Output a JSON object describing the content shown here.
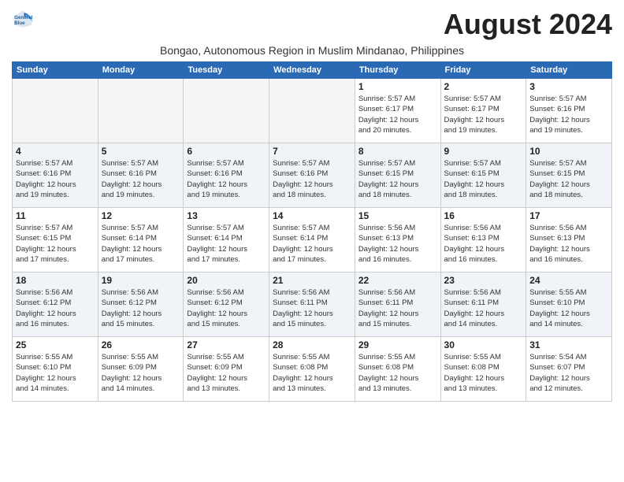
{
  "logo": {
    "general": "General",
    "blue": "Blue"
  },
  "title": "August 2024",
  "subtitle": "Bongao, Autonomous Region in Muslim Mindanao, Philippines",
  "weekdays": [
    "Sunday",
    "Monday",
    "Tuesday",
    "Wednesday",
    "Thursday",
    "Friday",
    "Saturday"
  ],
  "weeks": [
    [
      {
        "day": "",
        "info": ""
      },
      {
        "day": "",
        "info": ""
      },
      {
        "day": "",
        "info": ""
      },
      {
        "day": "",
        "info": ""
      },
      {
        "day": "1",
        "info": "Sunrise: 5:57 AM\nSunset: 6:17 PM\nDaylight: 12 hours\nand 20 minutes."
      },
      {
        "day": "2",
        "info": "Sunrise: 5:57 AM\nSunset: 6:17 PM\nDaylight: 12 hours\nand 19 minutes."
      },
      {
        "day": "3",
        "info": "Sunrise: 5:57 AM\nSunset: 6:16 PM\nDaylight: 12 hours\nand 19 minutes."
      }
    ],
    [
      {
        "day": "4",
        "info": "Sunrise: 5:57 AM\nSunset: 6:16 PM\nDaylight: 12 hours\nand 19 minutes."
      },
      {
        "day": "5",
        "info": "Sunrise: 5:57 AM\nSunset: 6:16 PM\nDaylight: 12 hours\nand 19 minutes."
      },
      {
        "day": "6",
        "info": "Sunrise: 5:57 AM\nSunset: 6:16 PM\nDaylight: 12 hours\nand 19 minutes."
      },
      {
        "day": "7",
        "info": "Sunrise: 5:57 AM\nSunset: 6:16 PM\nDaylight: 12 hours\nand 18 minutes."
      },
      {
        "day": "8",
        "info": "Sunrise: 5:57 AM\nSunset: 6:15 PM\nDaylight: 12 hours\nand 18 minutes."
      },
      {
        "day": "9",
        "info": "Sunrise: 5:57 AM\nSunset: 6:15 PM\nDaylight: 12 hours\nand 18 minutes."
      },
      {
        "day": "10",
        "info": "Sunrise: 5:57 AM\nSunset: 6:15 PM\nDaylight: 12 hours\nand 18 minutes."
      }
    ],
    [
      {
        "day": "11",
        "info": "Sunrise: 5:57 AM\nSunset: 6:15 PM\nDaylight: 12 hours\nand 17 minutes."
      },
      {
        "day": "12",
        "info": "Sunrise: 5:57 AM\nSunset: 6:14 PM\nDaylight: 12 hours\nand 17 minutes."
      },
      {
        "day": "13",
        "info": "Sunrise: 5:57 AM\nSunset: 6:14 PM\nDaylight: 12 hours\nand 17 minutes."
      },
      {
        "day": "14",
        "info": "Sunrise: 5:57 AM\nSunset: 6:14 PM\nDaylight: 12 hours\nand 17 minutes."
      },
      {
        "day": "15",
        "info": "Sunrise: 5:56 AM\nSunset: 6:13 PM\nDaylight: 12 hours\nand 16 minutes."
      },
      {
        "day": "16",
        "info": "Sunrise: 5:56 AM\nSunset: 6:13 PM\nDaylight: 12 hours\nand 16 minutes."
      },
      {
        "day": "17",
        "info": "Sunrise: 5:56 AM\nSunset: 6:13 PM\nDaylight: 12 hours\nand 16 minutes."
      }
    ],
    [
      {
        "day": "18",
        "info": "Sunrise: 5:56 AM\nSunset: 6:12 PM\nDaylight: 12 hours\nand 16 minutes."
      },
      {
        "day": "19",
        "info": "Sunrise: 5:56 AM\nSunset: 6:12 PM\nDaylight: 12 hours\nand 15 minutes."
      },
      {
        "day": "20",
        "info": "Sunrise: 5:56 AM\nSunset: 6:12 PM\nDaylight: 12 hours\nand 15 minutes."
      },
      {
        "day": "21",
        "info": "Sunrise: 5:56 AM\nSunset: 6:11 PM\nDaylight: 12 hours\nand 15 minutes."
      },
      {
        "day": "22",
        "info": "Sunrise: 5:56 AM\nSunset: 6:11 PM\nDaylight: 12 hours\nand 15 minutes."
      },
      {
        "day": "23",
        "info": "Sunrise: 5:56 AM\nSunset: 6:11 PM\nDaylight: 12 hours\nand 14 minutes."
      },
      {
        "day": "24",
        "info": "Sunrise: 5:55 AM\nSunset: 6:10 PM\nDaylight: 12 hours\nand 14 minutes."
      }
    ],
    [
      {
        "day": "25",
        "info": "Sunrise: 5:55 AM\nSunset: 6:10 PM\nDaylight: 12 hours\nand 14 minutes."
      },
      {
        "day": "26",
        "info": "Sunrise: 5:55 AM\nSunset: 6:09 PM\nDaylight: 12 hours\nand 14 minutes."
      },
      {
        "day": "27",
        "info": "Sunrise: 5:55 AM\nSunset: 6:09 PM\nDaylight: 12 hours\nand 13 minutes."
      },
      {
        "day": "28",
        "info": "Sunrise: 5:55 AM\nSunset: 6:08 PM\nDaylight: 12 hours\nand 13 minutes."
      },
      {
        "day": "29",
        "info": "Sunrise: 5:55 AM\nSunset: 6:08 PM\nDaylight: 12 hours\nand 13 minutes."
      },
      {
        "day": "30",
        "info": "Sunrise: 5:55 AM\nSunset: 6:08 PM\nDaylight: 12 hours\nand 13 minutes."
      },
      {
        "day": "31",
        "info": "Sunrise: 5:54 AM\nSunset: 6:07 PM\nDaylight: 12 hours\nand 12 minutes."
      }
    ]
  ]
}
